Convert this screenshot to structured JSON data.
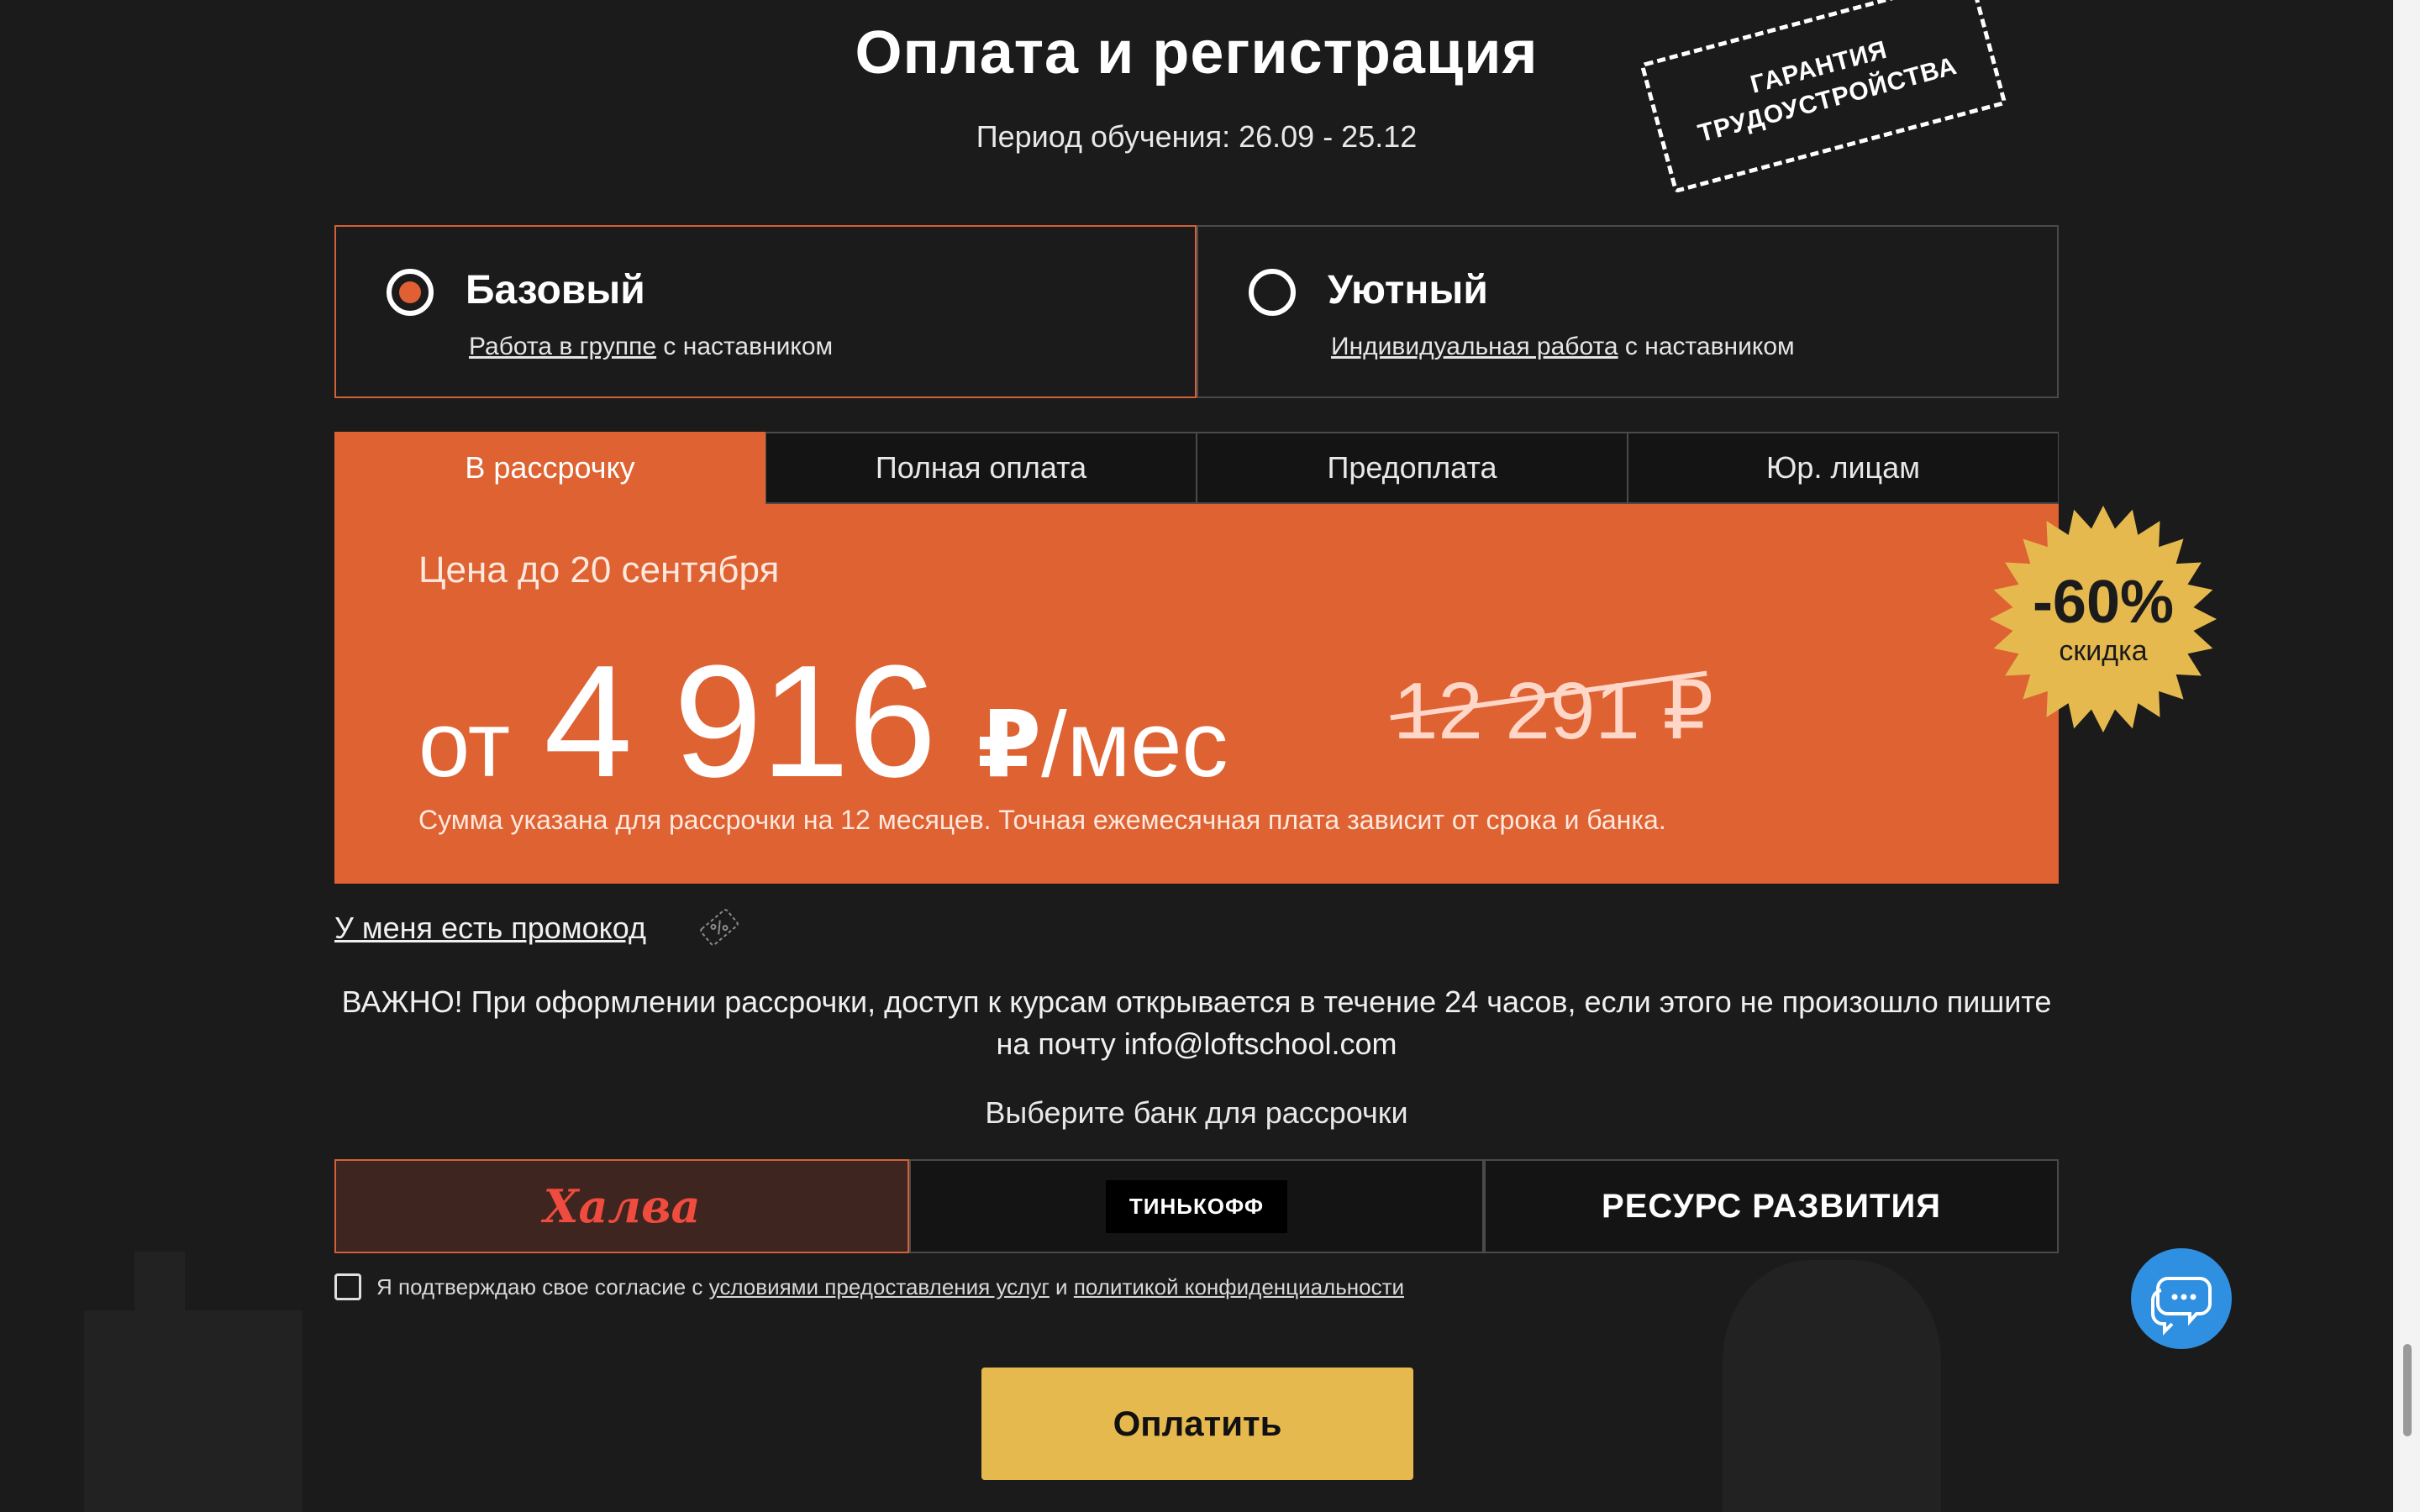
{
  "header": {
    "title": "Оплата и регистрация",
    "period": "Период обучения: 26.09 - 25.12",
    "stamp_line1": "ГАРАНТИЯ",
    "stamp_line2": "ТРУДОУСТРОЙСТВА"
  },
  "plans": [
    {
      "name": "Базовый",
      "desc_link": "Работа в группе",
      "desc_rest": " с наставником",
      "selected": true
    },
    {
      "name": "Уютный",
      "desc_link": "Индивидуальная работа",
      "desc_rest": " с наставником",
      "selected": false
    }
  ],
  "tabs": [
    {
      "label": "В рассрочку",
      "active": true
    },
    {
      "label": "Полная оплата",
      "active": false
    },
    {
      "label": "Предоплата",
      "active": false
    },
    {
      "label": "Юр. лицам",
      "active": false
    }
  ],
  "price": {
    "label": "Цена до 20 сентября",
    "from": "от",
    "amount": "4 916",
    "currency": "₽",
    "per": "/мес",
    "old": "12 291 ₽",
    "note": "Сумма указана для рассрочки на 12 месяцев. Точная ежемесячная плата зависит от срока и банка."
  },
  "badge": {
    "percent": "-60%",
    "text": "скидка"
  },
  "promo": {
    "label": "У меня есть промокод",
    "icon": "coupon-percent-icon"
  },
  "important": "ВАЖНО! При оформлении рассрочки, доступ к курсам открывается в течение 24 часов, если этого не произошло пишите на почту info@loftschool.com",
  "banks": {
    "title": "Выберите банк для рассрочки",
    "items": [
      {
        "label": "Халва",
        "selected": true
      },
      {
        "label": "ТИНЬКОФФ",
        "selected": false
      },
      {
        "label": "РЕСУРС РАЗВИТИЯ",
        "selected": false
      }
    ]
  },
  "consent": {
    "prefix": "Я подтверждаю свое согласие с ",
    "terms_link": "условиями предоставления услуг",
    "middle": " и ",
    "privacy_link": "политикой конфиденциальности"
  },
  "pay_button": "Оплатить",
  "chat_icon": "chat-bubbles-icon",
  "colors": {
    "accent": "#de6232",
    "button": "#e6b94f",
    "chat": "#2f8fe0",
    "background": "#1b1b1b"
  }
}
